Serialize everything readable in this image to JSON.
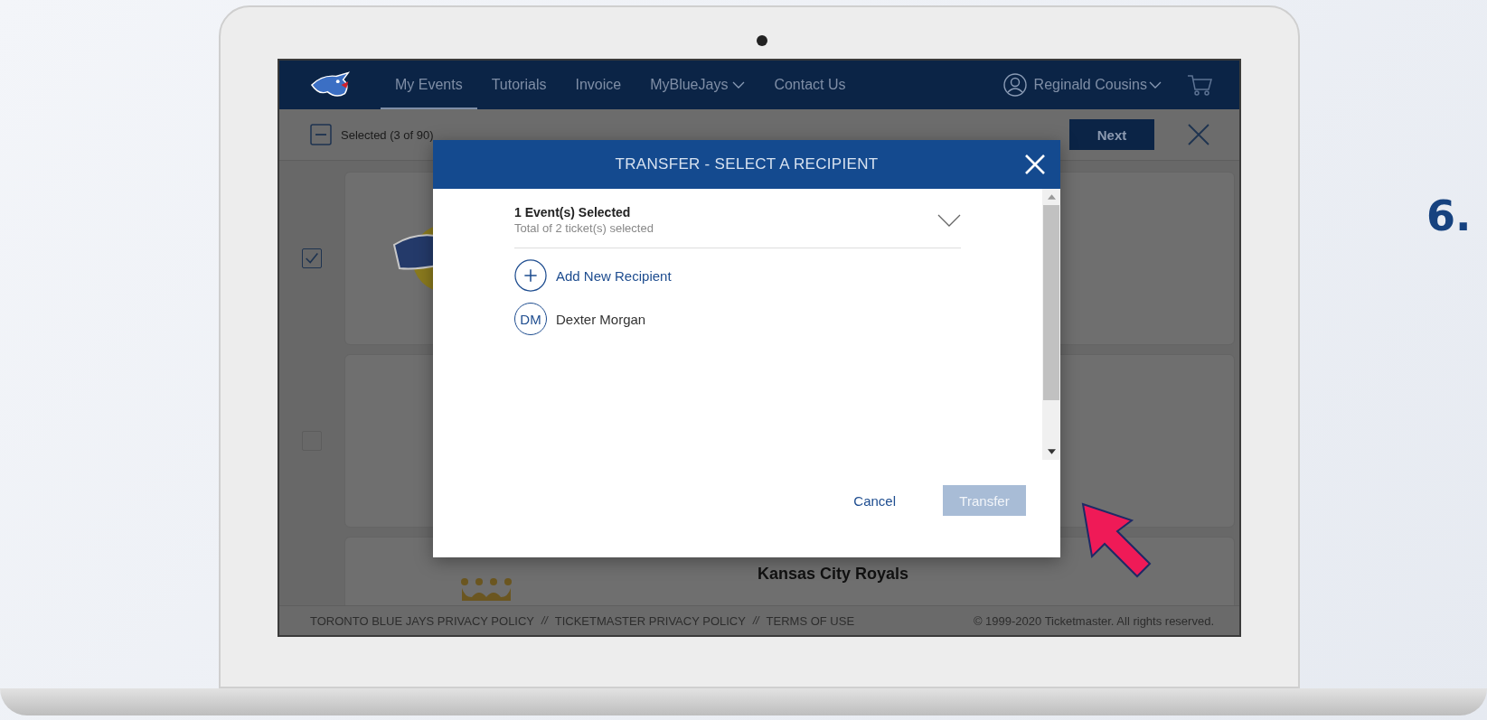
{
  "nav": {
    "items": [
      {
        "label": "My Events",
        "selected": true,
        "dropdown": false
      },
      {
        "label": "Tutorials",
        "selected": false,
        "dropdown": false
      },
      {
        "label": "Invoice",
        "selected": false,
        "dropdown": false
      },
      {
        "label": "MyBlueJays",
        "selected": false,
        "dropdown": true
      },
      {
        "label": "Contact Us",
        "selected": false,
        "dropdown": false
      }
    ],
    "user": "Reginald Cousins"
  },
  "toolbar": {
    "selection": "Selected (3 of 90)",
    "next": "Next"
  },
  "event_cards": [
    {
      "checked": true
    },
    {
      "checked": false
    }
  ],
  "partial_card": {
    "title": "Kansas City Royals"
  },
  "modal": {
    "title": "TRANSFER - SELECT A RECIPIENT",
    "summary": {
      "title": "1 Event(s) Selected",
      "subtitle": "Total of 2 ticket(s) selected",
      "expanded": false
    },
    "add_recipient": "Add New Recipient",
    "recipients": [
      {
        "initials": "DM",
        "name": "Dexter Morgan"
      }
    ],
    "cancel": "Cancel",
    "transfer": {
      "label": "Transfer",
      "disabled": true
    }
  },
  "footer": {
    "items": [
      {
        "kind": "link",
        "text": "TORONTO BLUE JAYS PRIVACY POLICY"
      },
      {
        "kind": "separator",
        "text": "//"
      },
      {
        "kind": "link",
        "text": "TICKETMASTER PRIVACY POLICY"
      },
      {
        "kind": "separator",
        "text": "//"
      },
      {
        "kind": "link",
        "text": "TERMS OF USE"
      }
    ],
    "copyright": "© 1999-2020 Ticketmaster. All rights reserved."
  },
  "step_label": "6."
}
